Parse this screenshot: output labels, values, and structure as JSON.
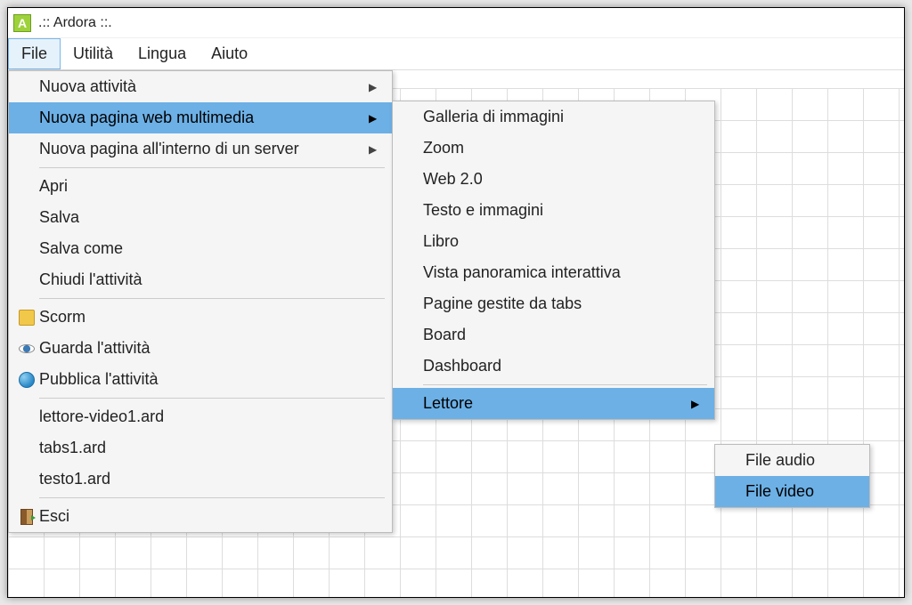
{
  "window": {
    "title": ".:: Ardora ::."
  },
  "menubar": {
    "file": "File",
    "utilita": "Utilità",
    "lingua": "Lingua",
    "aiuto": "Aiuto"
  },
  "menu1": {
    "nuova_attivita": "Nuova attività",
    "nuova_pagina_web": "Nuova pagina web multimedia",
    "nuova_pagina_server": "Nuova pagina all'interno di un server",
    "apri": "Apri",
    "salva": "Salva",
    "salva_come": "Salva come",
    "chiudi": "Chiudi l'attività",
    "scorm": "Scorm",
    "guarda": "Guarda l'attività",
    "pubblica": "Pubblica l'attività",
    "recent1": "lettore-video1.ard",
    "recent2": "tabs1.ard",
    "recent3": "testo1.ard",
    "esci": "Esci"
  },
  "menu2": {
    "galleria": "Galleria di immagini",
    "zoom": "Zoom",
    "web20": "Web 2.0",
    "testo": "Testo e immagini",
    "libro": "Libro",
    "vista": "Vista panoramica interattiva",
    "pagine": "Pagine gestite da tabs",
    "board": "Board",
    "dashboard": "Dashboard",
    "lettore": "Lettore"
  },
  "menu3": {
    "file_audio": "File audio",
    "file_video": "File video"
  }
}
